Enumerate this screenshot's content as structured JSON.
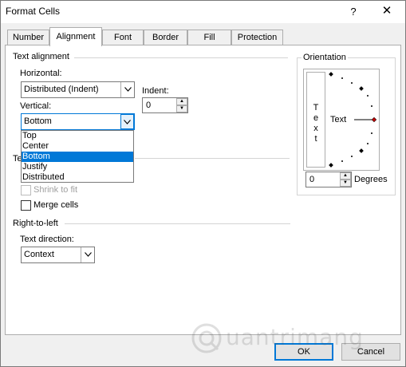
{
  "dialog": {
    "title": "Format Cells",
    "help_glyph": "?",
    "close_glyph": "✕"
  },
  "tabs": [
    {
      "label": "Number"
    },
    {
      "label": "Alignment"
    },
    {
      "label": "Font"
    },
    {
      "label": "Border"
    },
    {
      "label": "Fill"
    },
    {
      "label": "Protection"
    }
  ],
  "active_tab": "Alignment",
  "text_alignment": {
    "section_title": "Text alignment",
    "horizontal_label": "Horizontal:",
    "horizontal_value": "Distributed (Indent)",
    "vertical_label": "Vertical:",
    "vertical_value": "Bottom",
    "indent_label": "Indent:",
    "indent_value": "0",
    "vertical_options": [
      "Top",
      "Center",
      "Bottom",
      "Justify",
      "Distributed"
    ],
    "vertical_selected": "Bottom"
  },
  "text_control": {
    "section_title_partial": "Te",
    "shrink_label": "Shrink to fit",
    "merge_label": "Merge cells"
  },
  "right_to_left": {
    "section_title": "Right-to-left",
    "direction_label": "Text direction:",
    "direction_value": "Context"
  },
  "orientation": {
    "section_title": "Orientation",
    "vertical_text_letters": [
      "T",
      "e",
      "x",
      "t"
    ],
    "dial_label": "Text",
    "degrees_value": "0",
    "degrees_label": "Degrees"
  },
  "buttons": {
    "ok": "OK",
    "cancel": "Cancel"
  },
  "watermark": {
    "text": "uantrimang"
  },
  "colors": {
    "accent": "#0078d7",
    "dial_marker": "#c00000"
  }
}
